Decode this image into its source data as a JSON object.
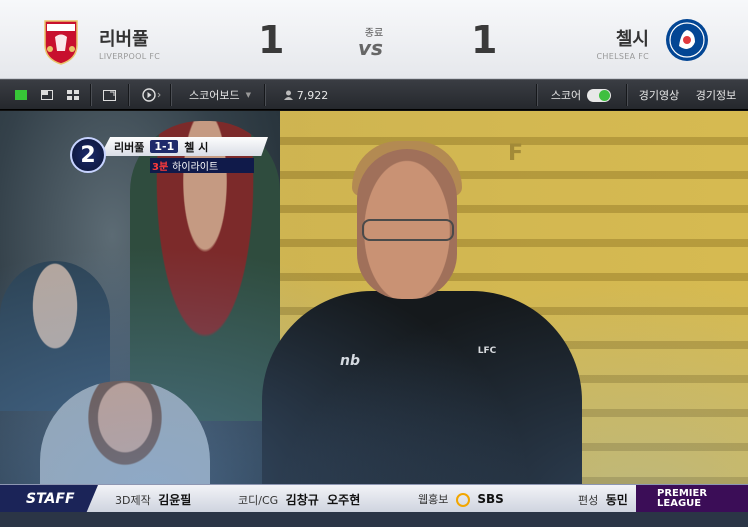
{
  "match": {
    "status": "종료",
    "vs": "vs",
    "home": {
      "name": "리버풀",
      "sub": "LIVERPOOL FC",
      "score": "1",
      "crest_icon": "liverpool-crest-icon",
      "color": "#c8102e"
    },
    "away": {
      "name": "첼시",
      "sub": "CHELSEA FC",
      "score": "1",
      "crest_icon": "chelsea-crest-icon",
      "color": "#034694"
    }
  },
  "toolbar": {
    "layout_icons": [
      "single-view-icon",
      "pip-view-icon",
      "grid-view-icon",
      "fullscreen-icon"
    ],
    "play_icon": "play-icon",
    "scoreboard_label": "스코어보드",
    "viewer_count": "7,922",
    "score_toggle_label": "스코어",
    "score_toggle_on": true,
    "highlight_label": "경기영상",
    "info_label": "경기정보"
  },
  "broadcast": {
    "overlay": {
      "number": "2",
      "home": "리버풀",
      "score": "1-1",
      "away": "첼 시",
      "minute": "3분",
      "caption": "하이라이트"
    },
    "ticker": {
      "tag": "STAFF",
      "items": [
        {
          "role": "3D제작",
          "name": "김윤필"
        },
        {
          "role": "코디/CG",
          "name": "김창규  오주현"
        },
        {
          "role": "웹홍보",
          "name": "SBS"
        },
        {
          "role": "편성",
          "name": "동민"
        }
      ],
      "league": "PREMIER LEAGUE"
    }
  }
}
